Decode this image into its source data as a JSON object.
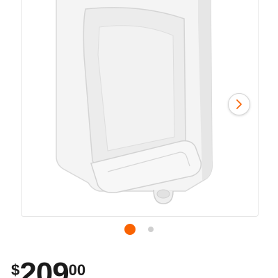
{
  "product": {
    "image_icon": "urinal-product-image",
    "next_icon": "chevron-right-icon"
  },
  "carousel": {
    "total_images": 2,
    "active_index": 0
  },
  "colors": {
    "accent": "#f96302",
    "dot_inactive": "#cfcfcf"
  },
  "price": {
    "currency": "$",
    "dollars": "209",
    "cents": "00"
  }
}
